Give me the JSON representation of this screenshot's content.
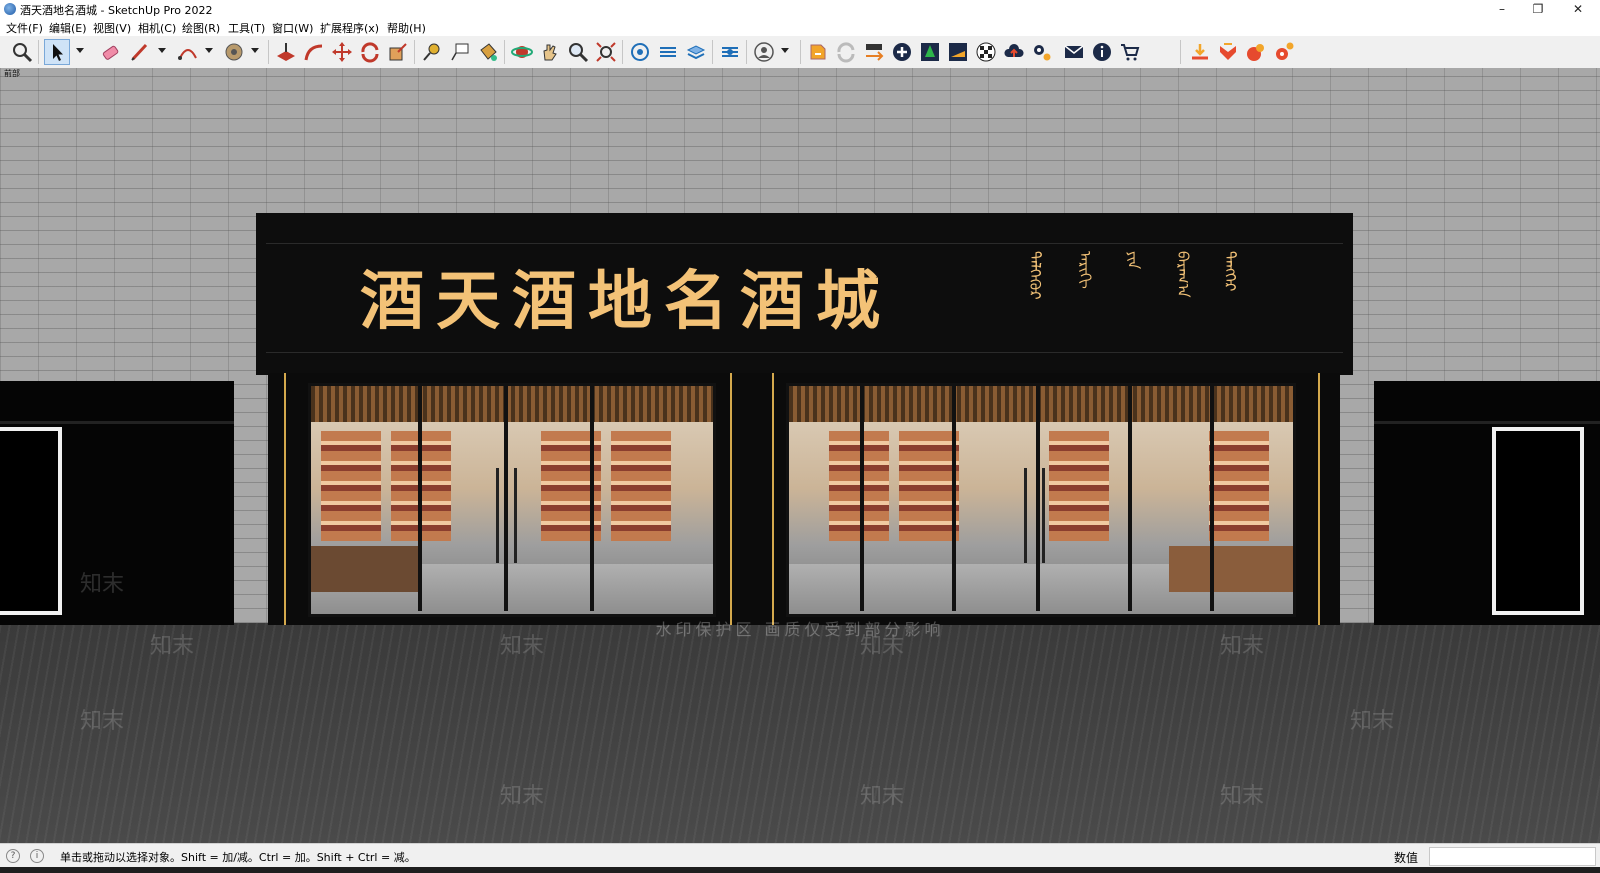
{
  "window": {
    "title": "酒天酒地名酒城 - SketchUp Pro 2022",
    "controls": {
      "minimize": "–",
      "maximize": "❐",
      "close": "✕"
    }
  },
  "menu": {
    "items": [
      "文件(F)",
      "编辑(E)",
      "视图(V)",
      "相机(C)",
      "绘图(R)",
      "工具(T)",
      "窗口(W)",
      "扩展程序(x)",
      "帮助(H)"
    ]
  },
  "toolbar": {
    "active_tool": "select-tool"
  },
  "viewport": {
    "scene_label": "前部",
    "sign": {
      "chinese_name": "酒天酒地名酒城",
      "mongolian_lines": [
        "ᠳᠡᠯᠭᠡᠭᠦᠷ",
        "ᠠᠷᠢᠬᠢ",
        "ᠶᠢᠨ",
        "ᠪᠠᠷᠠᠭ᠎ᠠ",
        "ᠲᠡᠩᠭᠡᠷ"
      ]
    },
    "watermark_brand": "知末",
    "watermark_notice": "水印保护区 画质仅受到部分影响"
  },
  "statusbar": {
    "hint": "单击或拖动以选择对象。Shift = 加/减。Ctrl = 加。Shift + Ctrl = 减。",
    "measurements_label": "数值",
    "measurements_value": ""
  },
  "colors": {
    "sign_text": "#f3c277",
    "gold_trim": "#d4a94d",
    "sign_background": "#0d0d0d"
  }
}
